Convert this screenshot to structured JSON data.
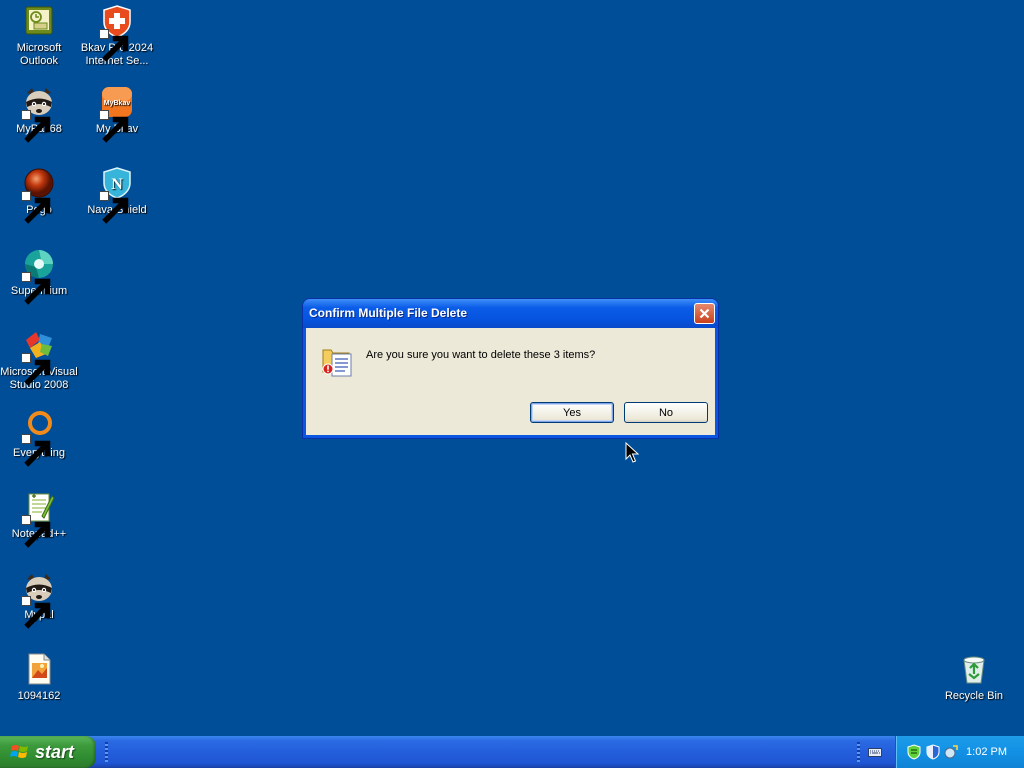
{
  "desktop": {
    "icons": [
      {
        "label": "Microsoft Outlook",
        "icon": "outlook-icon",
        "shortcut": false
      },
      {
        "label": "Bkav Pro 2024 Internet Se...",
        "icon": "bkav-shield-icon",
        "shortcut": true
      },
      {
        "label": "MyPal 68",
        "icon": "raccoon-icon",
        "shortcut": true
      },
      {
        "label": "My Bkav",
        "icon": "mybkav-icon",
        "shortcut": true
      },
      {
        "label": "Pego",
        "icon": "pego-icon",
        "shortcut": true
      },
      {
        "label": "Nava Shield",
        "icon": "nava-shield-icon",
        "shortcut": true
      },
      {
        "label": "Supermium",
        "icon": "supermium-icon",
        "shortcut": true
      },
      {
        "label": "Microsoft Visual Studio 2008",
        "icon": "visual-studio-icon",
        "shortcut": true
      },
      {
        "label": "Everything",
        "icon": "everything-icon",
        "shortcut": true
      },
      {
        "label": "Notepad++",
        "icon": "notepad-plus-plus-icon",
        "shortcut": true
      },
      {
        "label": "Mypal",
        "icon": "raccoon-icon",
        "shortcut": true
      },
      {
        "label": "1094162",
        "icon": "image-file-icon",
        "shortcut": false
      },
      {
        "label": "Recycle Bin",
        "icon": "recycle-bin-icon",
        "shortcut": false
      }
    ],
    "mybkav_badge": "MyBkav",
    "nava_letter": "N",
    "background_color": "#004e98"
  },
  "dialog": {
    "title": "Confirm Multiple File Delete",
    "message": "Are you sure you want to delete these 3 items?",
    "buttons": {
      "yes": "Yes",
      "no": "No"
    },
    "icon": "delete-files-icon"
  },
  "taskbar": {
    "start_label": "start",
    "clock": "1:02 PM",
    "tray_icons": [
      "bkav-tray-icon",
      "shield-tray-icon",
      "network-tray-icon"
    ],
    "keyboard_icon": "keyboard-icon"
  }
}
